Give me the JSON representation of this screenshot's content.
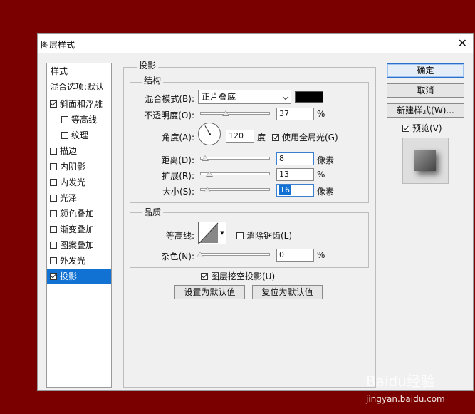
{
  "window": {
    "title": "图层样式",
    "close_icon": "close-icon"
  },
  "styles_panel": {
    "header": "样式",
    "blend_options": "混合选项:默认",
    "items": [
      {
        "label": "斜面和浮雕",
        "checked": true,
        "indent": false
      },
      {
        "label": "等高线",
        "checked": false,
        "indent": true
      },
      {
        "label": "纹理",
        "checked": false,
        "indent": true
      },
      {
        "label": "描边",
        "checked": false,
        "indent": false
      },
      {
        "label": "内阴影",
        "checked": false,
        "indent": false
      },
      {
        "label": "内发光",
        "checked": false,
        "indent": false
      },
      {
        "label": "光泽",
        "checked": false,
        "indent": false
      },
      {
        "label": "颜色叠加",
        "checked": false,
        "indent": false
      },
      {
        "label": "渐变叠加",
        "checked": false,
        "indent": false
      },
      {
        "label": "图案叠加",
        "checked": false,
        "indent": false
      },
      {
        "label": "外发光",
        "checked": false,
        "indent": false
      },
      {
        "label": "投影",
        "checked": true,
        "indent": false,
        "selected": true
      }
    ]
  },
  "drop_shadow": {
    "section_title": "投影",
    "structure": {
      "title": "结构",
      "blend_mode_label": "混合模式(B):",
      "blend_mode_value": "正片叠底",
      "blend_color": "#000000",
      "opacity_label": "不透明度(O):",
      "opacity_value": "37",
      "opacity_unit": "%",
      "angle_label": "角度(A):",
      "angle_value": "120",
      "angle_unit": "度",
      "global_light_label": "使用全局光(G)",
      "global_light_checked": true,
      "distance_label": "距离(D):",
      "distance_value": "8",
      "distance_unit": "像素",
      "spread_label": "扩展(R):",
      "spread_value": "13",
      "spread_unit": "%",
      "size_label": "大小(S):",
      "size_value": "16",
      "size_unit": "像素"
    },
    "quality": {
      "title": "品质",
      "contour_label": "等高线:",
      "anti_alias_label": "消除锯齿(L)",
      "anti_alias_checked": false,
      "noise_label": "杂色(N):",
      "noise_value": "0",
      "noise_unit": "%"
    },
    "knockout_label": "图层挖空投影(U)",
    "knockout_checked": true,
    "make_default": "设置为默认值",
    "reset_default": "复位为默认值"
  },
  "buttons": {
    "ok": "确定",
    "cancel": "取消",
    "new_style": "新建样式(W)...",
    "preview_label": "预览(V)",
    "preview_checked": true
  },
  "watermark": {
    "text": "Baidu经验",
    "sub": "jingyan.baidu.com"
  }
}
